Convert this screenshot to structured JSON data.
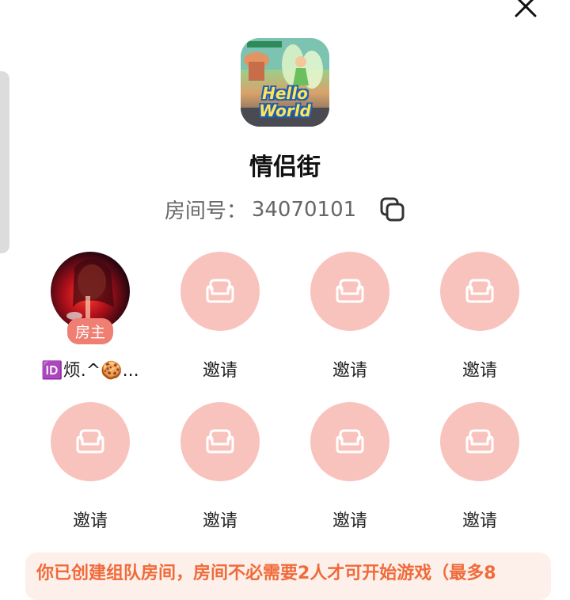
{
  "header": {
    "close_icon": "close-icon"
  },
  "app": {
    "icon_text_line1": "Hello",
    "icon_text_line2": "World"
  },
  "room": {
    "title": "情侣街",
    "number_label": "房间号：",
    "number": "34070101",
    "copy_icon": "copy-icon"
  },
  "seats": [
    {
      "type": "host",
      "name": "🆔烦.^🍪...",
      "badge": "房主"
    },
    {
      "type": "empty",
      "label": "邀请",
      "icon": "sofa-icon"
    },
    {
      "type": "empty",
      "label": "邀请",
      "icon": "sofa-icon"
    },
    {
      "type": "empty",
      "label": "邀请",
      "icon": "sofa-icon"
    },
    {
      "type": "empty",
      "label": "邀请",
      "icon": "sofa-icon"
    },
    {
      "type": "empty",
      "label": "邀请",
      "icon": "sofa-icon"
    },
    {
      "type": "empty",
      "label": "邀请",
      "icon": "sofa-icon"
    },
    {
      "type": "empty",
      "label": "邀请",
      "icon": "sofa-icon"
    }
  ],
  "notice": {
    "text": "你已创建组队房间，房间不必需要2人才可开始游戏（最多8"
  },
  "colors": {
    "seat_bg": "#f8c3bd",
    "badge_bg": "#f07f73",
    "notice_text": "#f06a3a"
  }
}
